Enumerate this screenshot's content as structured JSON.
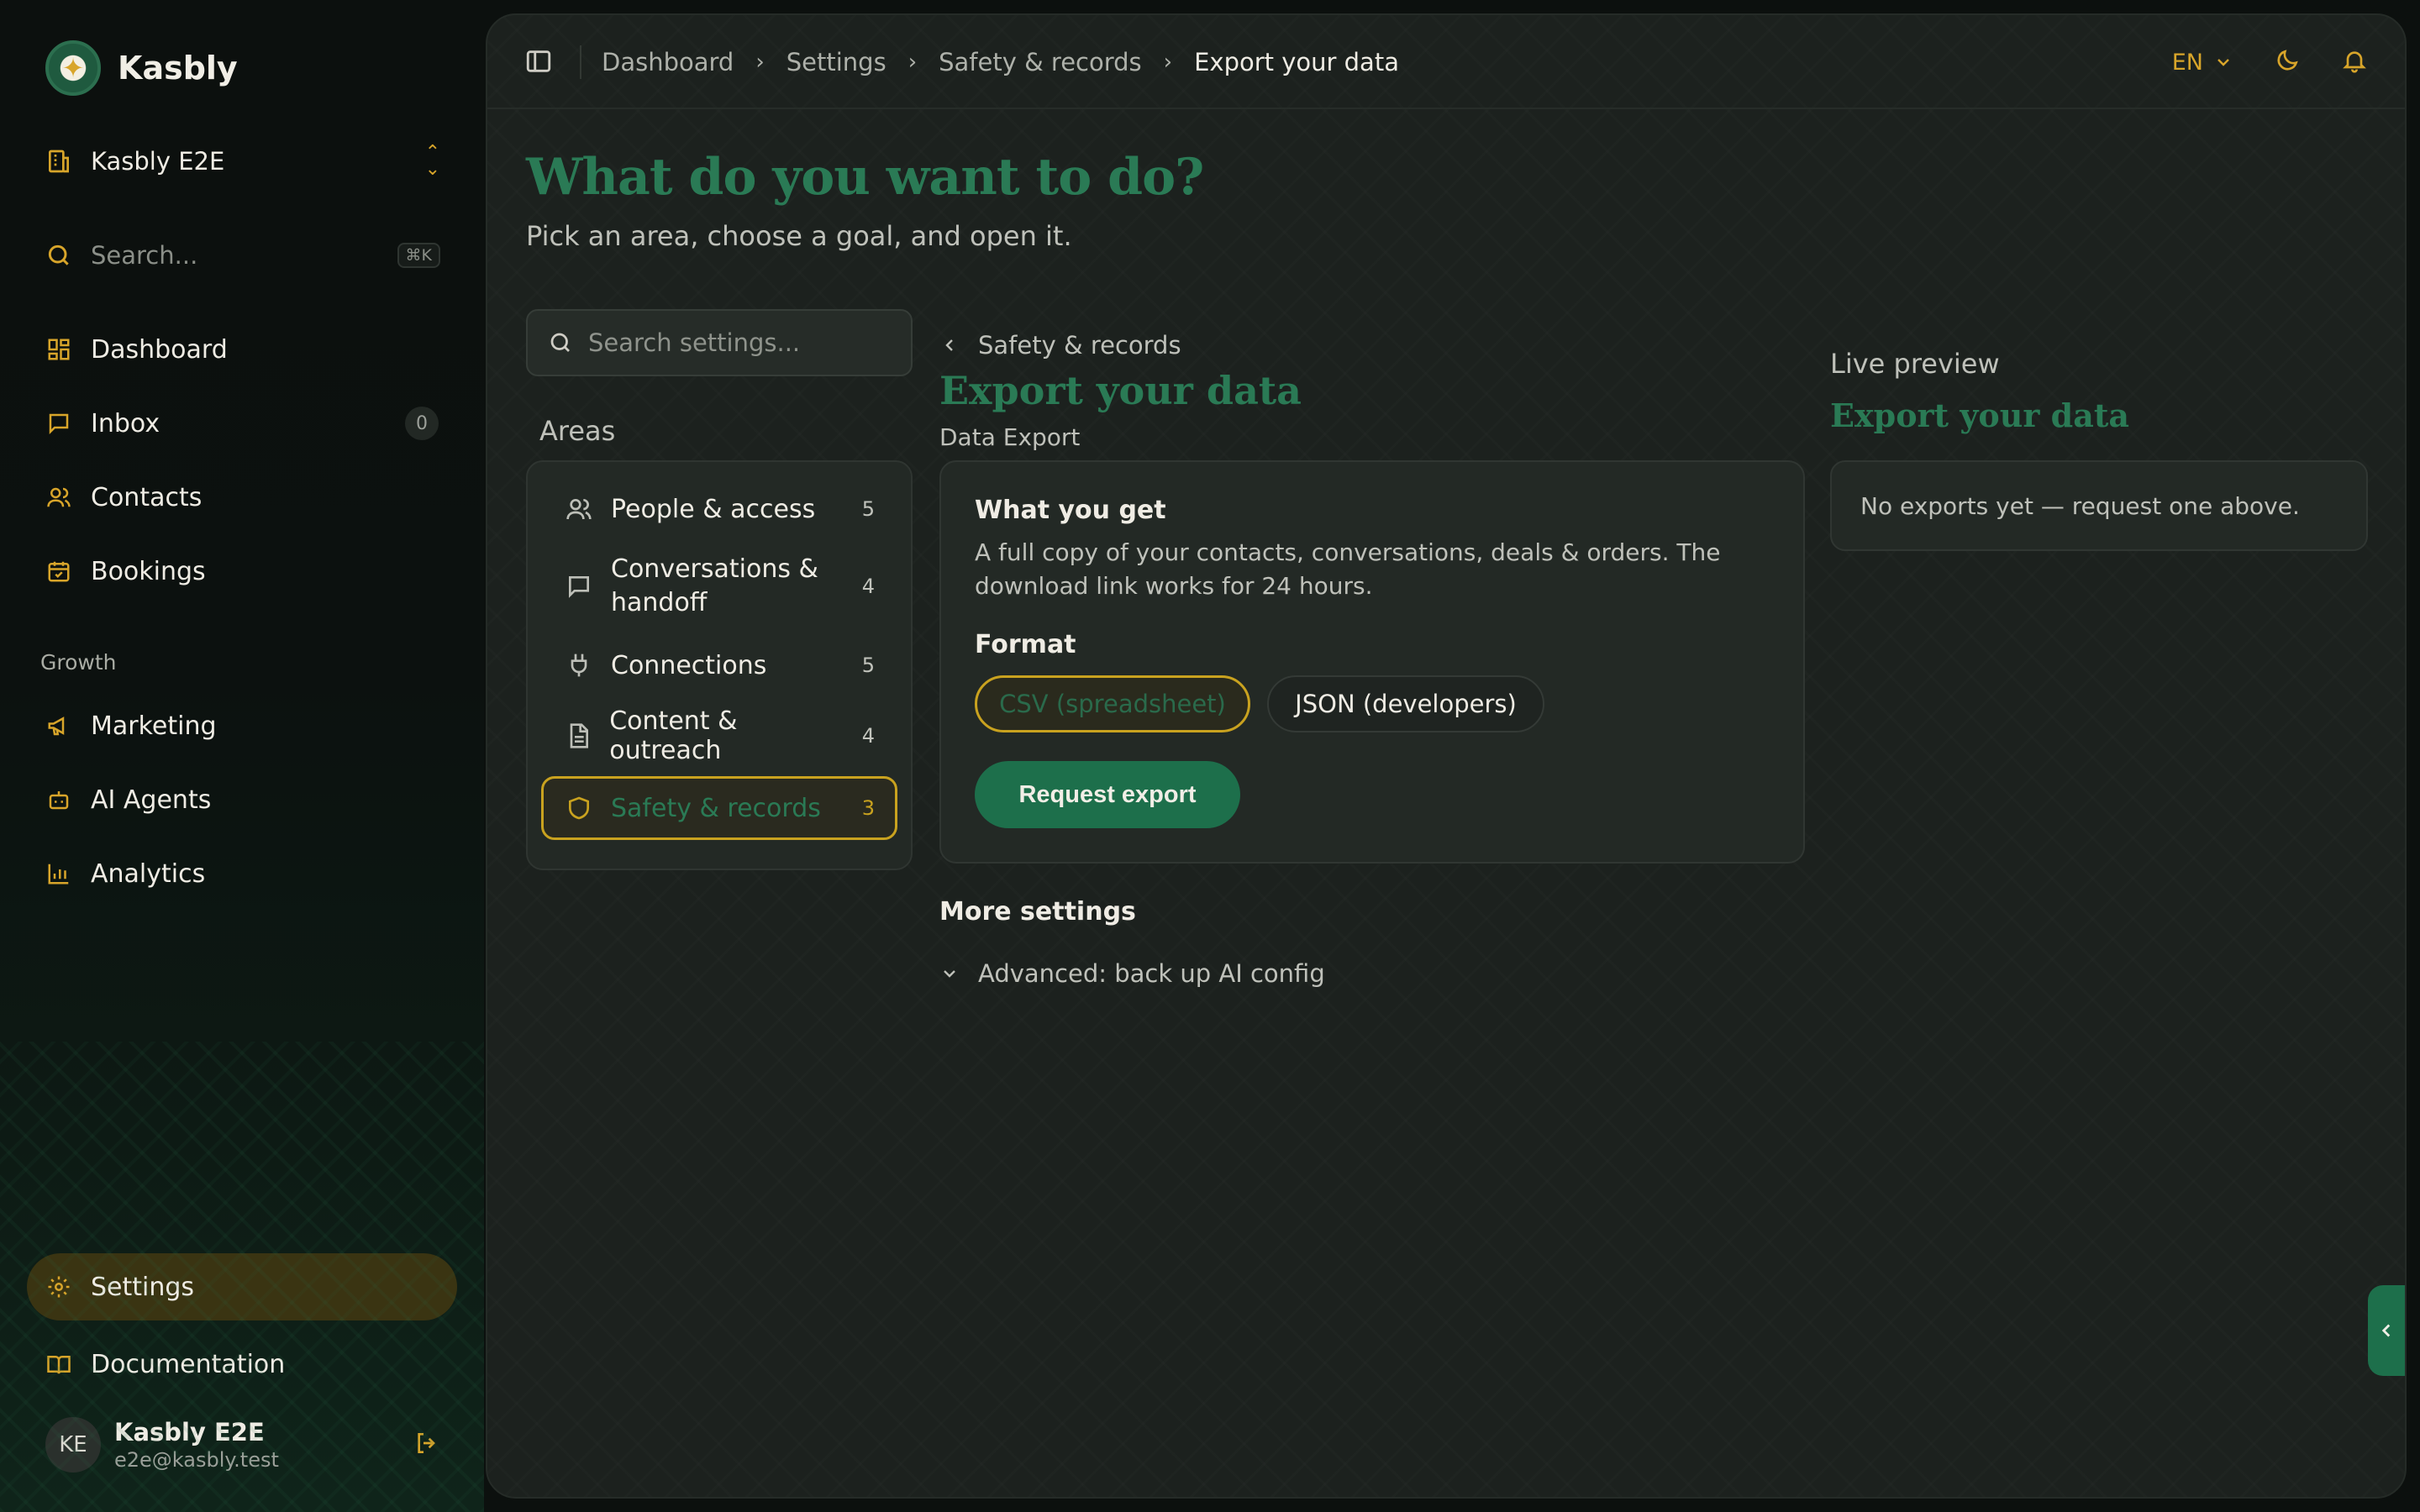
{
  "app": {
    "name": "Kasbly"
  },
  "workspace": {
    "name": "Kasbly E2E"
  },
  "sidebar_search": {
    "placeholder": "Search...",
    "shortcut": "⌘K"
  },
  "nav": {
    "dashboard": "Dashboard",
    "inbox": "Inbox",
    "inbox_count": "0",
    "contacts": "Contacts",
    "bookings": "Bookings",
    "growth_label": "Growth",
    "marketing": "Marketing",
    "ai_agents": "AI Agents",
    "analytics": "Analytics",
    "settings": "Settings",
    "documentation": "Documentation"
  },
  "user": {
    "initials": "KE",
    "name": "Kasbly E2E",
    "email": "e2e@kasbly.test"
  },
  "breadcrumb": [
    "Dashboard",
    "Settings",
    "Safety & records",
    "Export your data"
  ],
  "topbar": {
    "language": "EN"
  },
  "page": {
    "title": "What do you want to do?",
    "subtitle": "Pick an area, choose a goal, and open it."
  },
  "settings_search": {
    "placeholder": "Search settings..."
  },
  "areas": {
    "label": "Areas",
    "items": [
      {
        "label": "People & access",
        "count": "5"
      },
      {
        "label": "Conversations & handoff",
        "count": "4"
      },
      {
        "label": "Connections",
        "count": "5"
      },
      {
        "label": "Content & outreach",
        "count": "4"
      },
      {
        "label": "Safety & records",
        "count": "3"
      }
    ]
  },
  "detail": {
    "back_label": "Safety & records",
    "title": "Export your data",
    "subtitle": "Data Export",
    "card_heading": "What you get",
    "card_body": "A full copy of your contacts, conversations, deals & orders. The download link works for 24 hours.",
    "format_label": "Format",
    "format_options": [
      "CSV (spreadsheet)",
      "JSON (developers)"
    ],
    "format_selected": "CSV (spreadsheet)",
    "request_button": "Request export",
    "more_settings": "More settings",
    "advanced_label": "Advanced: back up AI config"
  },
  "preview": {
    "label": "Live preview",
    "title": "Export your data",
    "empty_text": "No exports yet — request one above."
  },
  "colors": {
    "accent_gold": "#d8a52a",
    "brand_green": "#1d6f4b",
    "title_green": "#2a7a55",
    "active_nav_bg": "#3a3412"
  }
}
